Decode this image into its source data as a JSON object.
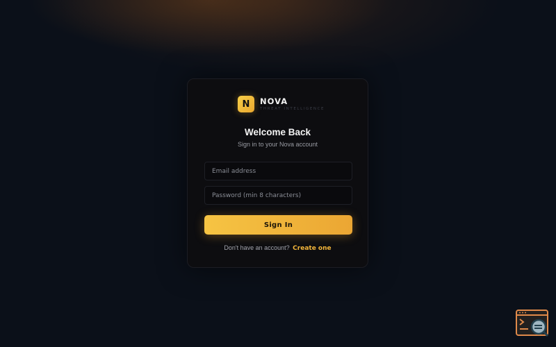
{
  "brand": {
    "logo_letter": "N",
    "name": "NOVA",
    "tagline": "THREAT INTELLIGENCE"
  },
  "login": {
    "title": "Welcome Back",
    "subtitle": "Sign in to your Nova account",
    "email_placeholder": "Email address",
    "password_placeholder": "Password (min 8 characters)",
    "submit_label": "Sign In",
    "footer_text": "Don't have an account?",
    "footer_link": "Create one"
  },
  "colors": {
    "background": "#0b1019",
    "card": "#0d0d10",
    "accent": "#f2b53a",
    "button_gradient_start": "#f6c443",
    "button_gradient_end": "#eba633"
  },
  "icons": {
    "corner_widget": "terminal-search-icon"
  }
}
